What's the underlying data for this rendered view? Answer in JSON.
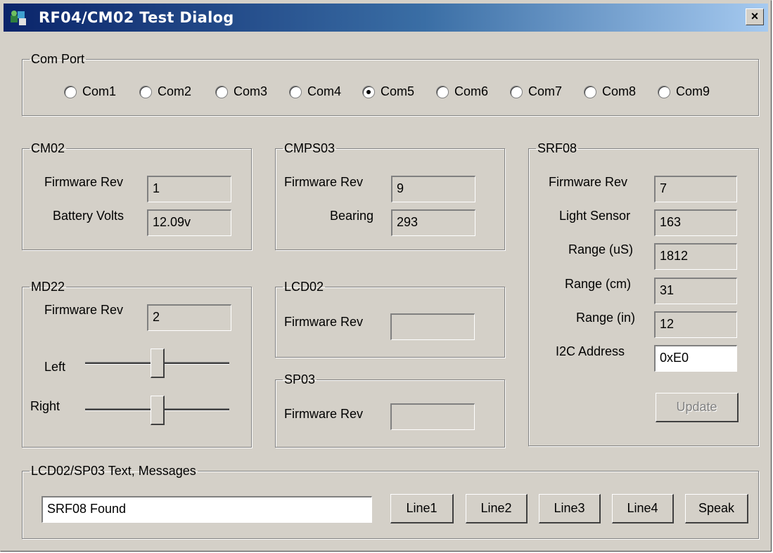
{
  "window": {
    "title": "RF04/CM02 Test Dialog",
    "close_label": "×"
  },
  "comport": {
    "legend": "Com Port",
    "options": [
      "Com1",
      "Com2",
      "Com3",
      "Com4",
      "Com5",
      "Com6",
      "Com7",
      "Com8",
      "Com9"
    ],
    "selected": "Com5"
  },
  "cm02": {
    "legend": "CM02",
    "firmware_label": "Firmware Rev",
    "firmware_value": "1",
    "battery_label": "Battery Volts",
    "battery_value": "12.09v"
  },
  "cmps03": {
    "legend": "CMPS03",
    "firmware_label": "Firmware Rev",
    "firmware_value": "9",
    "bearing_label": "Bearing",
    "bearing_value": "293"
  },
  "srf08": {
    "legend": "SRF08",
    "firmware_label": "Firmware Rev",
    "firmware_value": "7",
    "light_label": "Light Sensor",
    "light_value": "163",
    "range_us_label": "Range (uS)",
    "range_us_value": "1812",
    "range_cm_label": "Range (cm)",
    "range_cm_value": "31",
    "range_in_label": "Range (in)",
    "range_in_value": "12",
    "i2c_label": "I2C Address",
    "i2c_value": "0xE0",
    "update_label": "Update"
  },
  "md22": {
    "legend": "MD22",
    "firmware_label": "Firmware Rev",
    "firmware_value": "2",
    "left_label": "Left",
    "right_label": "Right",
    "left_level": 0.5,
    "right_level": 0.5
  },
  "lcd02": {
    "legend": "LCD02",
    "firmware_label": "Firmware Rev",
    "firmware_value": ""
  },
  "sp03": {
    "legend": "SP03",
    "firmware_label": "Firmware Rev",
    "firmware_value": ""
  },
  "messages": {
    "legend": "LCD02/SP03 Text, Messages",
    "text_value": "SRF08 Found",
    "buttons": [
      "Line1",
      "Line2",
      "Line3",
      "Line4",
      "Speak"
    ]
  },
  "colors": {
    "face": "#d4d0c8",
    "title_start": "#0a246a",
    "title_end": "#a6caf0"
  }
}
